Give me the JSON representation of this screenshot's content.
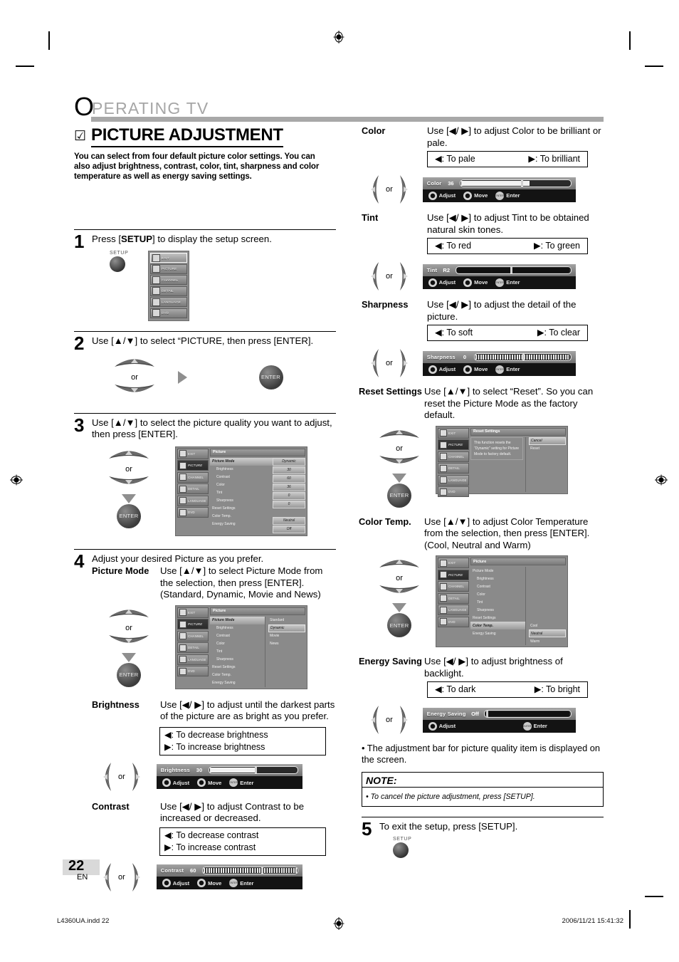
{
  "header": {
    "drop_cap": "O",
    "title": "PERATING  TV"
  },
  "section": {
    "check_icon": "☑",
    "heading": "PICTURE ADJUSTMENT",
    "intro": "You can select from four default picture color settings.  You can also adjust brightness, contrast, color, tint, sharpness and color temperature as well as energy saving settings."
  },
  "steps": {
    "s1": {
      "number": "1",
      "text_a": "Press [",
      "bold": "SETUP",
      "text_b": "] to display the setup screen."
    },
    "s2": {
      "number": "2",
      "text": "Use [▲/▼] to select “PICTURE, then press [ENTER]."
    },
    "s3": {
      "number": "3",
      "text": "Use [▲/▼] to select the picture quality you want to adjust, then press [ENTER]."
    },
    "s4": {
      "number": "4",
      "text": "Adjust your desired Picture as you prefer."
    },
    "s5": {
      "number": "5",
      "text": "To exit the setup, press [SETUP]."
    }
  },
  "remote": {
    "or_label": "or",
    "enter_label": "ENTER",
    "setup_label": "SETUP"
  },
  "setup_menu": {
    "items": [
      {
        "label": "EXIT",
        "icon": "exit-icon",
        "selected": true
      },
      {
        "label": "PICTURE",
        "icon": "picture-icon",
        "selected": false
      },
      {
        "label": "CHANNEL",
        "icon": "channel-icon",
        "selected": false
      },
      {
        "label": "DETAIL",
        "icon": "detail-icon",
        "selected": false
      },
      {
        "label": "LANGUAGE",
        "icon": "language-icon",
        "selected": false
      },
      {
        "label": "DVD",
        "icon": "dvd-icon",
        "selected": false
      }
    ]
  },
  "picture_menu": {
    "title": "Picture",
    "side_items": [
      "EXIT",
      "PICTURE",
      "CHANNEL",
      "DETAIL",
      "LANGUAGE",
      "DVD"
    ],
    "rows": [
      {
        "name": "Picture Mode",
        "value": "Dynamic",
        "indent": false,
        "highlight": true,
        "boxed": true
      },
      {
        "name": "Brightness",
        "value": "30",
        "indent": true,
        "highlight": false,
        "boxed": true
      },
      {
        "name": "Contrast",
        "value": "60",
        "indent": true,
        "highlight": false,
        "boxed": true
      },
      {
        "name": "Color",
        "value": "36",
        "indent": true,
        "highlight": false,
        "boxed": true
      },
      {
        "name": "Tint",
        "value": "0",
        "indent": true,
        "highlight": false,
        "boxed": true
      },
      {
        "name": "Sharpness",
        "value": "0",
        "indent": true,
        "highlight": false,
        "boxed": true
      },
      {
        "name": "Reset Settings",
        "value": "",
        "indent": false,
        "highlight": false,
        "boxed": false
      },
      {
        "name": "Color Temp.",
        "value": "Neutral",
        "indent": false,
        "highlight": false,
        "boxed": true
      },
      {
        "name": "Energy Saving",
        "value": "Off",
        "indent": false,
        "highlight": false,
        "boxed": true
      }
    ]
  },
  "picture_mode_menu": {
    "title": "Picture",
    "rows": [
      "Picture Mode",
      "Brightness",
      "Contrast",
      "Color",
      "Tint",
      "Sharpness",
      "Reset Settings",
      "Color Temp.",
      "Energy Saving"
    ],
    "options": [
      "Standard",
      "Dynamic",
      "Movie",
      "News"
    ],
    "selected_option": "Dynamic"
  },
  "reset_menu": {
    "title": "Reset Settings",
    "message": "This function resets the “Dynamic” setting for Picture Mode to factory default.",
    "options": [
      "Cancel",
      "Reset"
    ],
    "selected_option": "Cancel"
  },
  "color_temp_menu": {
    "title": "Picture",
    "rows": [
      "Picture Mode",
      "Brightness",
      "Contrast",
      "Color",
      "Tint",
      "Sharpness",
      "Reset Settings",
      "Color Temp.",
      "Energy Saving"
    ],
    "highlight_row": "Color Temp.",
    "options": [
      "Cool",
      "Neutral",
      "Warm"
    ],
    "selected_option": "Neutral"
  },
  "items": {
    "picture_mode": {
      "label": "Picture Mode",
      "desc": "Use [▲/▼] to select Picture Mode from the selection, then press [ENTER]. (Standard, Dynamic, Movie and News)"
    },
    "brightness": {
      "label": "Brightness",
      "desc": "Use [◀/ ▶] to adjust until the darkest parts of the picture are as bright as you prefer.",
      "legend_left": "◀: To decrease brightness",
      "legend_right": "▶: To increase brightness",
      "osd": {
        "label": "Brightness",
        "value": "30"
      }
    },
    "contrast": {
      "label": "Contrast",
      "desc": "Use [◀/ ▶] to adjust Contrast to be increased or decreased.",
      "legend_left": "◀: To decrease contrast",
      "legend_right": "▶: To increase contrast",
      "osd": {
        "label": "Contrast",
        "value": "60"
      }
    },
    "color": {
      "label": "Color",
      "desc": "Use [◀/ ▶] to adjust Color to be brilliant or pale.",
      "legend_left": "◀: To pale",
      "legend_right": "▶: To brilliant",
      "osd": {
        "label": "Color",
        "value": "36"
      }
    },
    "tint": {
      "label": "Tint",
      "desc": "Use [◀/ ▶] to adjust Tint to be obtained natural skin tones.",
      "legend_left": "◀: To red",
      "legend_right": "▶: To green",
      "osd": {
        "label": "Tint",
        "value": "R2"
      }
    },
    "sharpness": {
      "label": "Sharpness",
      "desc": "Use [◀/ ▶] to adjust the detail of the picture.",
      "legend_left": "◀: To soft",
      "legend_right": "▶: To clear",
      "osd": {
        "label": "Sharpness",
        "value": "0"
      }
    },
    "reset_settings": {
      "label": "Reset Settings",
      "desc": "Use [▲/▼] to select “Reset”. So you can reset the Picture Mode as the factory default."
    },
    "color_temp": {
      "label": "Color Temp.",
      "desc": "Use [▲/▼] to adjust Color Temperature from the selection, then press [ENTER]. (Cool, Neutral and Warm)"
    },
    "energy_saving": {
      "label": "Energy Saving",
      "desc": "Use [◀/ ▶] to adjust brightness of backlight.",
      "legend_left": "◀: To dark",
      "legend_right": "▶: To bright",
      "osd": {
        "label": "Energy Saving",
        "value": "Off"
      }
    }
  },
  "osd_keys": {
    "adjust": "Adjust",
    "move": "Move",
    "enter": "Enter",
    "enter_glyph": "ENTER"
  },
  "bullet": "• The adjustment bar for picture quality item is displayed on the screen.",
  "note": {
    "title": "NOTE:",
    "body": "• To cancel the picture adjustment, press [SETUP]."
  },
  "page": {
    "number": "22",
    "lang": "EN"
  },
  "footer": {
    "left": "L4360UA.indd   22",
    "right": "2006/11/21   15:41:32"
  }
}
